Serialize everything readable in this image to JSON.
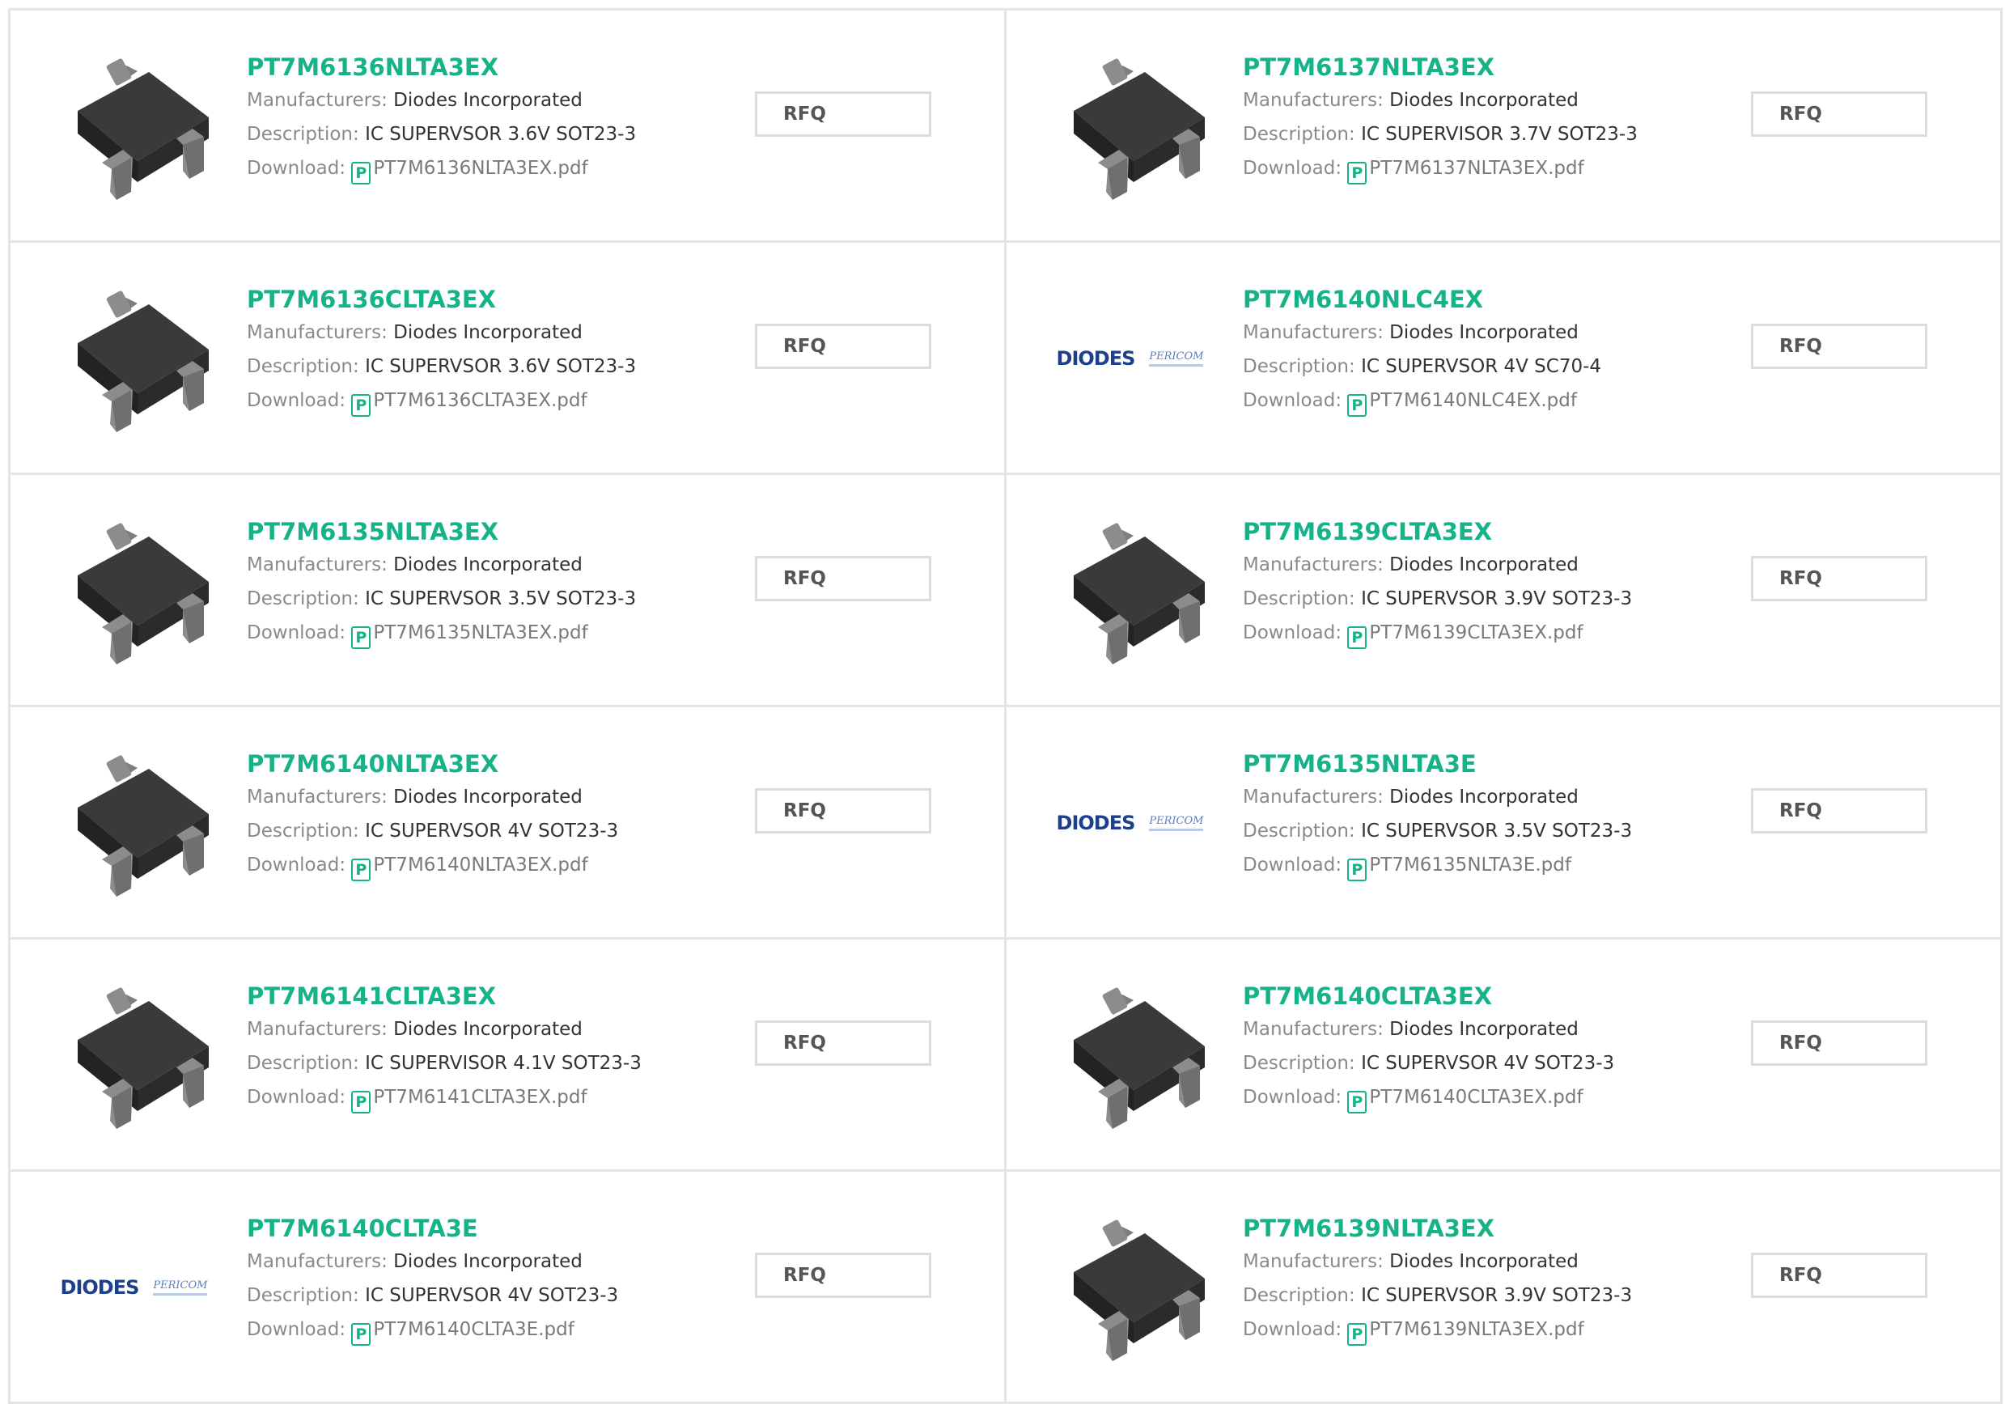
{
  "labels": {
    "manufacturers": "Manufacturers:",
    "description": "Description:",
    "download": "Download:",
    "rfq": "RFQ",
    "pdf_glyph": "P"
  },
  "logo": {
    "diodes": "DIODES",
    "pericom": "PERICOM"
  },
  "colors": {
    "accent": "#16b388",
    "border": "#e4e4e4",
    "chip": "#2b2b2b",
    "lead": "#8c8c8c"
  },
  "products": [
    {
      "part": "PT7M6136NLTA3EX",
      "manufacturer": "Diodes Incorporated",
      "description": "IC SUPERVSOR 3.6V SOT23-3",
      "file": "PT7M6136NLTA3EX.pdf",
      "image": "sot23-chip-image"
    },
    {
      "part": "PT7M6137NLTA3EX",
      "manufacturer": "Diodes Incorporated",
      "description": "IC SUPERVISOR 3.7V SOT23-3",
      "file": "PT7M6137NLTA3EX.pdf",
      "image": "sot23-chip-image"
    },
    {
      "part": "PT7M6136CLTA3EX",
      "manufacturer": "Diodes Incorporated",
      "description": "IC SUPERVSOR 3.6V SOT23-3",
      "file": "PT7M6136CLTA3EX.pdf",
      "image": "sot23-chip-image"
    },
    {
      "part": "PT7M6140NLC4EX",
      "manufacturer": "Diodes Incorporated",
      "description": "IC SUPERVSOR 4V SC70-4",
      "file": "PT7M6140NLC4EX.pdf",
      "image": "diodes-pericom-logo"
    },
    {
      "part": "PT7M6135NLTA3EX",
      "manufacturer": "Diodes Incorporated",
      "description": "IC SUPERVSOR 3.5V SOT23-3",
      "file": "PT7M6135NLTA3EX.pdf",
      "image": "sot23-chip-image"
    },
    {
      "part": "PT7M6139CLTA3EX",
      "manufacturer": "Diodes Incorporated",
      "description": "IC SUPERVSOR 3.9V SOT23-3",
      "file": "PT7M6139CLTA3EX.pdf",
      "image": "sot23-chip-image"
    },
    {
      "part": "PT7M6140NLTA3EX",
      "manufacturer": "Diodes Incorporated",
      "description": "IC SUPERVSOR 4V SOT23-3",
      "file": "PT7M6140NLTA3EX.pdf",
      "image": "sot23-chip-image"
    },
    {
      "part": "PT7M6135NLTA3E",
      "manufacturer": "Diodes Incorporated",
      "description": "IC SUPERVSOR 3.5V SOT23-3",
      "file": "PT7M6135NLTA3E.pdf",
      "image": "diodes-pericom-logo"
    },
    {
      "part": "PT7M6141CLTA3EX",
      "manufacturer": "Diodes Incorporated",
      "description": "IC SUPERVISOR 4.1V SOT23-3",
      "file": "PT7M6141CLTA3EX.pdf",
      "image": "sot23-chip-image"
    },
    {
      "part": "PT7M6140CLTA3EX",
      "manufacturer": "Diodes Incorporated",
      "description": "IC SUPERVSOR 4V SOT23-3",
      "file": "PT7M6140CLTA3EX.pdf",
      "image": "sot23-chip-image"
    },
    {
      "part": "PT7M6140CLTA3E",
      "manufacturer": "Diodes Incorporated",
      "description": "IC SUPERVSOR 4V SOT23-3",
      "file": "PT7M6140CLTA3E.pdf",
      "image": "diodes-pericom-logo"
    },
    {
      "part": "PT7M6139NLTA3EX",
      "manufacturer": "Diodes Incorporated",
      "description": "IC SUPERVSOR 3.9V SOT23-3",
      "file": "PT7M6139NLTA3EX.pdf",
      "image": "sot23-chip-image"
    }
  ]
}
